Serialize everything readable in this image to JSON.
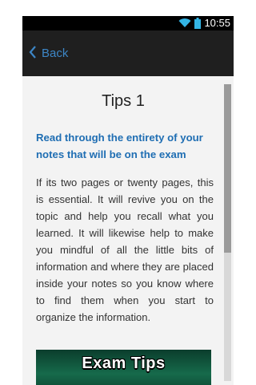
{
  "status_bar": {
    "time": "10:55",
    "icons": [
      "wifi-icon",
      "battery-icon"
    ]
  },
  "action_bar": {
    "back_label": "Back",
    "back_icon": "chevron-left-icon"
  },
  "article": {
    "title": "Tips 1",
    "subheading": "Read through the entirety of your notes that will be on the exam",
    "body": "If its two pages or twenty pages, this is essential. It will revive you on the topic and help you recall what you learned. It will likewise help to make you mindful of all the little bits of information and where they are placed inside your notes so you know where to find them when you start to organize the information.",
    "banner_text": "Exam Tips"
  },
  "colors": {
    "accent": "#3d86c6",
    "subheading": "#1f6eb3",
    "banner": "#166a4b"
  }
}
